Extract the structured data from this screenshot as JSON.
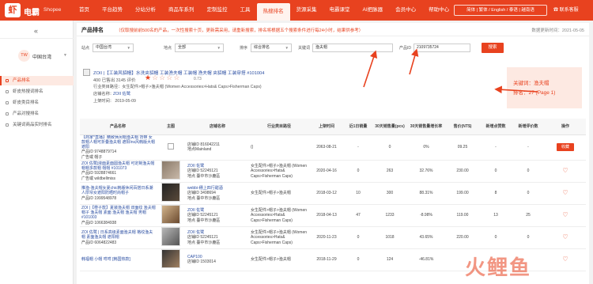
{
  "brand": {
    "logo": "虾",
    "name": "电霸",
    "sub": "Shopee"
  },
  "nav": [
    "首页",
    "平台趋势",
    "分站分析",
    "商品车系列",
    "定制监控",
    "工具",
    "热搜排名",
    "货源采集",
    "电霸课堂",
    "AI把脉器",
    "会员中心",
    "帮助中心"
  ],
  "lang": "简体 | 繁体 / English / 泰语 | 越南语",
  "contact": "联系客服",
  "sidebar": {
    "site": "中国台湾",
    "avatar": "TW",
    "items": [
      "产品排名",
      "虾皮热搜词排名",
      "虾皮类目排名",
      "产品对搜排名",
      "关键词商品实时排名"
    ]
  },
  "page": {
    "title": "产品排名",
    "note": "（仅取搜前前500名的产品，一次性搜索十页，更新需采用，请重新搜索，排名将根据五个搜索条件进行每24小时，结果供参考）",
    "update": "数据更新时间：2021-05-05"
  },
  "filters": {
    "site_label": "站点",
    "site": "中国台湾",
    "area_label": "地点",
    "area": "全部",
    "sort_label": "排序",
    "sort": "综合排名",
    "keyword_label": "关键词",
    "keyword": "渔夫帽",
    "product_label": "产品ID",
    "product_id": "2109735724",
    "search": "搜索"
  },
  "product": {
    "name": "ZOII |【工装风貂帽】水洗夹貂帽 工装渔夫帽 工装帽 渔夫帽 夹貂帽 工装穿搭 #101004",
    "stats": "400 已售出  3145 评价",
    "rating": "0.73",
    "category": "行业类目路径：女生配件>帽子>渔夫帽 (Women Accessories>Hats& Caps>Fisherman Caps)",
    "shop_label": "店铺名称：",
    "shop": "ZOII 佐鹭",
    "date": "上架时间：  2019-05-09"
  },
  "annotation": {
    "keyword": "关键词：渔夫帽",
    "rank": "排名：27 (Page 1)"
  },
  "table": {
    "headers": [
      "产品名称",
      "主图",
      "店铺名称",
      "行业类目路径",
      "上架时间",
      "近1日销量",
      "30天销售量(pcs)",
      "30天销售量增长率",
      "售价(NT$)",
      "新增点赞数",
      "新增评价数",
      "操作"
    ],
    "rows": [
      {
        "name": "【商家*直播】精致休闲帽渔夫帽 背带 女款帽人帽可折叠渔夫帽 遮阳Ins风韩版大帽遮阳",
        "pid": "产品ID 9748879714",
        "brand": "广告或 帽子",
        "shop": "店铺ID 816042211",
        "loc": "地点Mainland",
        "cat": "()",
        "date": "2063-08-21",
        "d1": "-",
        "s30": "0",
        "g30": "0%",
        "price": "09.25",
        "likes": "-",
        "reviews": "-",
        "op": "收藏"
      },
      {
        "name": "ZOI 佐鹭|液面素面圆渔夫帽 可定制渔夫帽 帽帽多款帽 帽帽 #101073",
        "pid": "产品ID 5928874661",
        "brand": "广告或 wildbellmiss",
        "shop": "ZOII 佐鹭",
        "sid": "店铺ID 52245121",
        "loc": "地点 臺中市沙鹿區",
        "cat": "女生配件>帽子>渔夫帽 (Women Accessories>Hats& Caps>Fisherman Caps)",
        "date": "2020-04-16",
        "d1": "0",
        "s30": "263",
        "g30": "32.76%",
        "price": "230.00",
        "likes": "0",
        "reviews": "0",
        "op": "♡"
      },
      {
        "name": "推渔-渔夫帽女夏chic韩版休闲百搭日系潮人厚帘女遮阳防晒时尚帽子",
        "pid": "产品ID 1999548978",
        "brand": "",
        "shop": "webbi-穗上四行甜酒",
        "sid": "店铺ID 3498694",
        "loc": "地点 臺中市沙鹿區",
        "cat": "女生配件>帽子>渔夫帽",
        "date": "2018-03-12",
        "d1": "10",
        "s30": "300",
        "g30": "88.31%",
        "price": "199.00",
        "likes": "8",
        "reviews": "0",
        "op": "♡"
      },
      {
        "name": "ZOI |【橙子款】夏装渔夫帽 双面纹 渔夫帽 帽子 渔夫帽 素面 渔夫帽 渔夫帽 男帽 #101003",
        "pid": "产品ID 1066384938",
        "brand": "",
        "shop": "ZOII 佐鹭",
        "sid": "店铺ID 52245121",
        "loc": "地点 臺中市沙鹿區",
        "cat": "女生配件>帽子>渔夫帽 (Women Accessories>Hats& Caps>Fisherman Caps)",
        "date": "2018-04-13",
        "d1": "47",
        "s30": "1233",
        "g30": "-8.98%",
        "price": "119.00",
        "likes": "13",
        "reviews": "25",
        "op": "♡"
      },
      {
        "name": "ZOI 佐鹭 | 日系高级素面渔夫帽 格纹渔夫帽 素面渔夫帽 遮阳帽",
        "pid": "产品ID 6064822483",
        "brand": "",
        "shop": "ZOII 佐鹭",
        "sid": "店铺ID 52245121",
        "loc": "地点 臺中市沙鹿區",
        "cat": "女生配件>帽子>渔夫帽 (Women Accessories>Hats& Caps>Fisherman Caps)",
        "date": "2020-11-23",
        "d1": "0",
        "s30": "1018",
        "g30": "43.65%",
        "price": "220.00",
        "likes": "0",
        "reviews": "0",
        "op": "♡"
      },
      {
        "name": "韩福帽 小帽 咩咩 [韩国热款]",
        "pid": "",
        "brand": "",
        "shop": "CAP100",
        "sid": "店铺ID 1503014",
        "loc": "",
        "cat": "女生配件>帽子>渔夫帽",
        "date": "2018-11-29",
        "d1": "0",
        "s30": "124",
        "g30": "-46.81%",
        "price": "",
        "likes": "",
        "reviews": "",
        "op": "♡"
      }
    ]
  },
  "watermark": "火鲤鱼"
}
